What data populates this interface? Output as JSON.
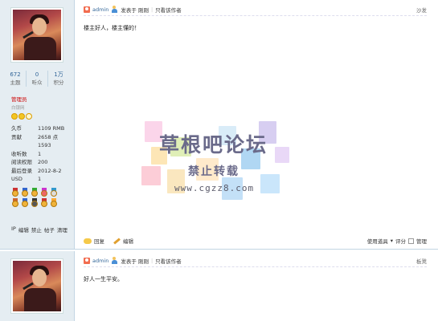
{
  "posts": [
    {
      "author": "admin",
      "posted_label": "发表于 刚刚",
      "only_author": "只看该作者",
      "floor": "沙发",
      "body": "楼主好人，楼主懂的！",
      "stats": [
        {
          "num": "672",
          "label": "主题"
        },
        {
          "num": "0",
          "label": "听众"
        },
        {
          "num": "1万",
          "label": "积分"
        }
      ],
      "group": "管理员",
      "group_sub": "白银网",
      "info": [
        {
          "k": "久币",
          "v": "1109 RMB"
        },
        {
          "k": "贡献",
          "v": "2658 点"
        },
        {
          "k": "",
          "v": "1593"
        },
        {
          "k": "收听数",
          "v": "1"
        },
        {
          "k": "阅读权限",
          "v": "200"
        },
        {
          "k": "最后登录",
          "v": "2012-8-2"
        },
        {
          "k": "USD",
          "v": "1"
        }
      ],
      "admin_links": [
        "IP",
        "编辑",
        "禁止",
        "帖子",
        "清理"
      ],
      "footer": {
        "reply": "回复",
        "edit": "编辑",
        "use_item": "使用道具",
        "rate": "评分",
        "manage": "管理"
      }
    },
    {
      "author": "admin",
      "posted_label": "发表于 刚刚",
      "only_author": "只看该作者",
      "floor": "板凳",
      "body": "好人一生平安。"
    }
  ],
  "watermark": {
    "title": "草根吧论坛",
    "subtitle": "禁止转载",
    "url": "www.cgzz8.com"
  }
}
